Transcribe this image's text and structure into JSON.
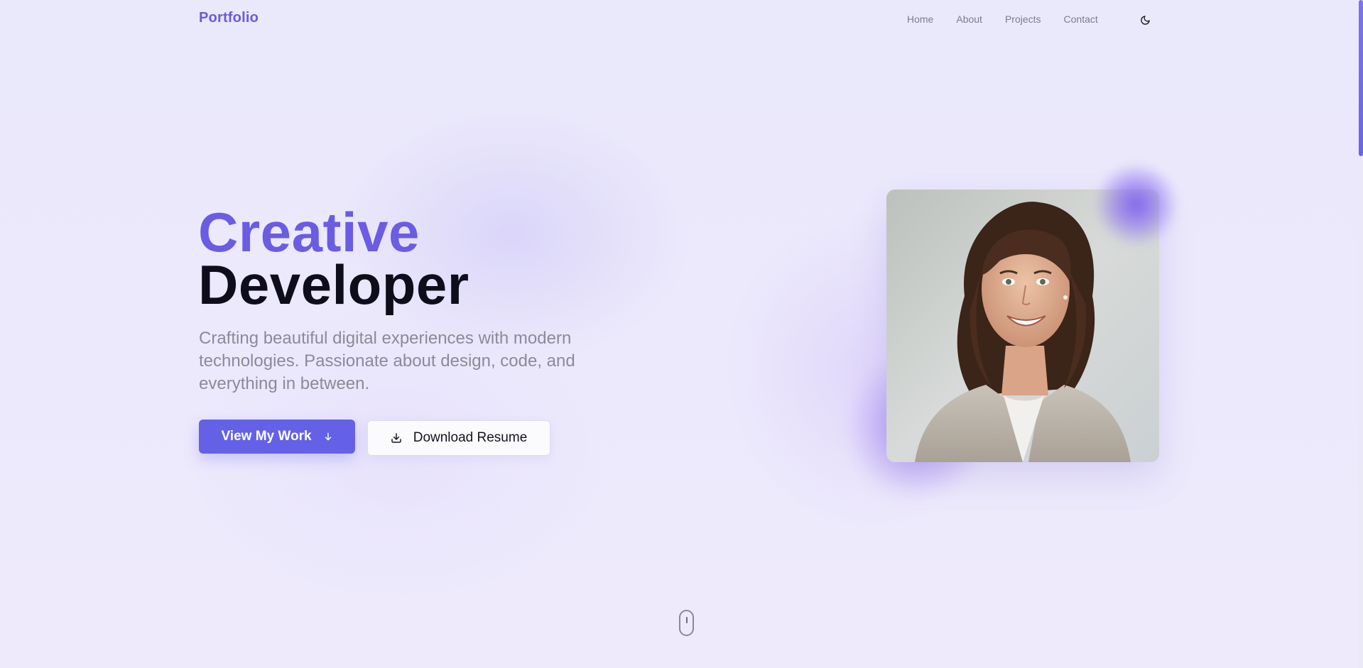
{
  "nav": {
    "brand": "Portfolio",
    "links": [
      "Home",
      "About",
      "Projects",
      "Contact"
    ],
    "theme_toggle_icon": "moon-icon"
  },
  "hero": {
    "title_line1": "Creative",
    "title_line2": "Developer",
    "description": "Crafting beautiful digital experiences with modern technologies. Passionate about design, code, and everything in between.",
    "primary_button": {
      "label": "View My Work",
      "icon": "arrow-down-icon"
    },
    "secondary_button": {
      "label": "Download Resume",
      "icon": "download-icon"
    }
  },
  "portrait": {
    "icon": "portrait-photo"
  },
  "scroll_indicator": {
    "icon": "mouse-scroll-icon"
  },
  "colors": {
    "accent": "#6a5ce3",
    "primary_button": "#6461e6",
    "heading_dark": "#0e0d1c",
    "muted_text": "#8c8a98",
    "background": "#ece9fb"
  }
}
